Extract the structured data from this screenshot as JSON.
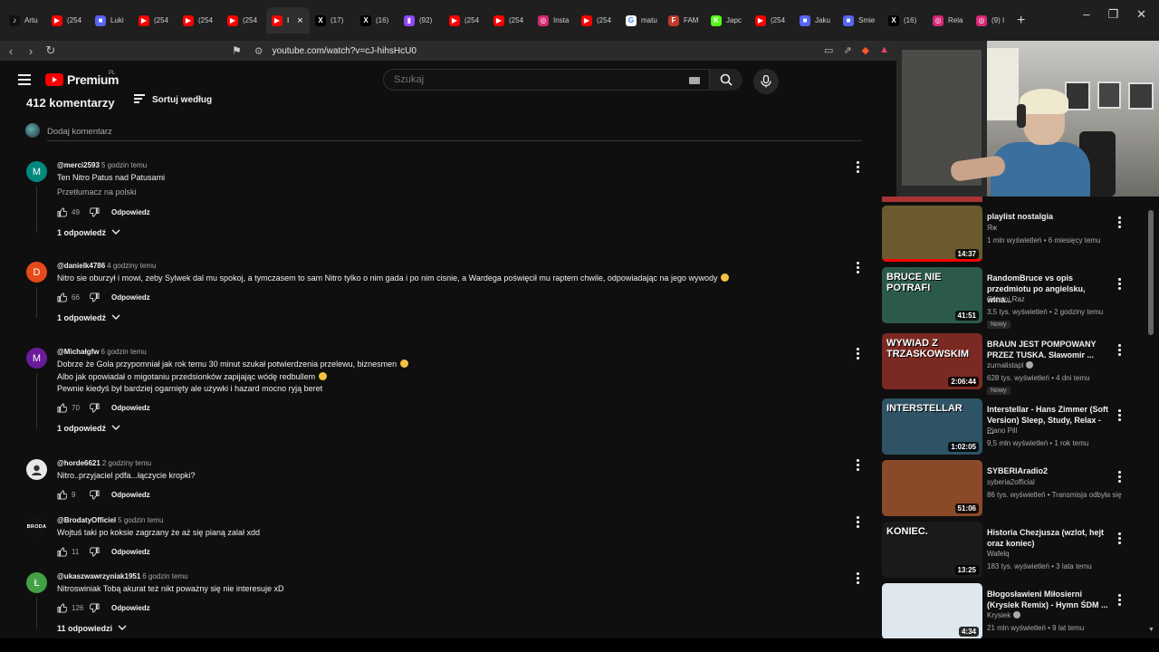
{
  "tabs": [
    {
      "label": "Artu",
      "icon": "tiktok-icon",
      "color": "#111111",
      "glyph": "♪"
    },
    {
      "label": "(254",
      "icon": "youtube-icon",
      "color": "#ff0000",
      "glyph": "▶"
    },
    {
      "label": "Luki",
      "icon": "app-icon",
      "color": "#5865f2",
      "glyph": "■"
    },
    {
      "label": "(254",
      "icon": "youtube-icon",
      "color": "#ff0000",
      "glyph": "▶"
    },
    {
      "label": "(254",
      "icon": "youtube-icon",
      "color": "#ff0000",
      "glyph": "▶"
    },
    {
      "label": "(254",
      "icon": "youtube-icon",
      "color": "#ff0000",
      "glyph": "▶"
    },
    {
      "label": "I",
      "icon": "youtube-icon",
      "color": "#ff0000",
      "glyph": "▶",
      "active": true
    },
    {
      "label": "(17)",
      "icon": "x-icon",
      "color": "#000000",
      "glyph": "X"
    },
    {
      "label": "(16)",
      "icon": "x-icon",
      "color": "#000000",
      "glyph": "X"
    },
    {
      "label": "(92)",
      "icon": "twitch-icon",
      "color": "#9146ff",
      "glyph": "▮"
    },
    {
      "label": "(254",
      "icon": "youtube-icon",
      "color": "#ff0000",
      "glyph": "▶"
    },
    {
      "label": "(254",
      "icon": "youtube-icon",
      "color": "#ff0000",
      "glyph": "▶"
    },
    {
      "label": "Insta",
      "icon": "instagram-icon",
      "color": "#d62976",
      "glyph": "◎"
    },
    {
      "label": "(254",
      "icon": "youtube-icon",
      "color": "#ff0000",
      "glyph": "▶"
    },
    {
      "label": "matu",
      "icon": "google-icon",
      "color": "#ffffff",
      "glyph": "G"
    },
    {
      "label": "FAM",
      "icon": "fame-icon",
      "color": "#c0392b",
      "glyph": "F"
    },
    {
      "label": "Japc",
      "icon": "kick-icon",
      "color": "#53fc18",
      "glyph": "K"
    },
    {
      "label": "(254",
      "icon": "youtube-icon",
      "color": "#ff0000",
      "glyph": "▶"
    },
    {
      "label": "Jaku",
      "icon": "app-icon",
      "color": "#5865f2",
      "glyph": "■"
    },
    {
      "label": "Smie",
      "icon": "app-icon",
      "color": "#5865f2",
      "glyph": "■"
    },
    {
      "label": "(16)",
      "icon": "x-icon",
      "color": "#000000",
      "glyph": "X"
    },
    {
      "label": "Rela",
      "icon": "instagram-icon",
      "color": "#d62976",
      "glyph": "◎"
    },
    {
      "label": "(9) I",
      "icon": "instagram-icon",
      "color": "#d62976",
      "glyph": "◎"
    }
  ],
  "address_bar": {
    "url": "youtube.com/watch?v=cJ-hihsHcU0"
  },
  "masthead": {
    "logo_text": "Premium",
    "region": "PL",
    "search_placeholder": "Szukaj"
  },
  "comments_section": {
    "count_label": "412 komentarzy",
    "sort_label": "Sortuj według",
    "add_comment_placeholder": "Dodaj komentarz"
  },
  "comments": [
    {
      "author": "@merci2593",
      "time": "5 godzin temu",
      "avatar_letter": "M",
      "avatar_color": "#00897b",
      "lines": [
        "Ten Nitro Patus nad Patusami"
      ],
      "translate": "Przetłumacz na polski",
      "likes": "49",
      "reply_label": "Odpowiedz",
      "replies_label": "1 odpowiedź"
    },
    {
      "author": "@danielk4786",
      "time": "4 godziny temu",
      "avatar_letter": "D",
      "avatar_color": "#e64a19",
      "lines": [
        "Nitro sie oburzył i mowi, zeby Sylwek dal mu spokoj, a tymczasem to sam Nitro tylko o nim gada i po nim cisnie, a Wardega poświęcił mu raptem chwile, odpowiadając na jego wywody"
      ],
      "likes": "66",
      "reply_label": "Odpowiedz",
      "replies_label": "1 odpowiedź"
    },
    {
      "author": "@Michałgfw",
      "time": "6 godzin temu",
      "avatar_letter": "M",
      "avatar_color": "#6a1b9a",
      "lines": [
        "Dobrze że Gola przypomniał jak rok temu 30 minut szukał potwierdzenia przelewu, biznesmen",
        "Albo jak opowiadał o migotaniu przedsionków zapijając wódę redbullem",
        "Pewnie kiedyś był bardziej ogarnięty ale używki i hazard mocno ryją beret"
      ],
      "likes": "70",
      "reply_label": "Odpowiedz",
      "replies_label": "1 odpowiedź"
    },
    {
      "author": "@horde6621",
      "time": "2 godziny temu",
      "avatar_letter": "",
      "avatar_color": "#e8e8e8",
      "lines": [
        "Nitro..przyjaciel pdfa...łączycie kropki?"
      ],
      "likes": "9",
      "reply_label": "Odpowiedz"
    },
    {
      "author": "@BrodatyOfficiel",
      "time": "5 godzin temu",
      "avatar_letter": "BRODA",
      "avatar_color": "#111111",
      "lines": [
        "Wojtuś taki po koksie zagrzany że aż się pianą zalał xdd"
      ],
      "likes": "11",
      "reply_label": "Odpowiedz"
    },
    {
      "author": "@ukaszwawrzyniak1951",
      "time": "6 godzin temu",
      "avatar_letter": "Ł",
      "avatar_color": "#43a047",
      "lines": [
        "Nitroswiniak Tobą akurat też nikt poważny się nie interesuje xD"
      ],
      "likes": "126",
      "reply_label": "Odpowiedz",
      "replies_label": "11 odpowiedzi"
    }
  ],
  "sidebar": [
    {
      "title": "playlist nostalgia",
      "channel": "Яж",
      "meta": "1 mln wyświetleń • 6 miesięcy temu",
      "duration": "14:37",
      "thumb_color": "#6b5a2e",
      "progress": 1.0
    },
    {
      "title": "RandomBruce vs opis przedmiotu po angielsku, wina...",
      "channel": "Ostatni Raz",
      "meta": "3,5 tys. wyświetleń • 2 godziny temu",
      "badge": "Nowy",
      "duration": "41:51",
      "thumb_color": "#2c5a4a",
      "thumb_text": "BRUCE NIE POTRAFI"
    },
    {
      "title": "BRAUN JEST POMPOWANY PRZEZ TUSKA. Sławomir ...",
      "channel": "zurnalistapl",
      "verified": true,
      "meta": "628 tys. wyświetleń • 4 dni temu",
      "badge": "Nowy",
      "duration": "2:06:44",
      "thumb_color": "#7a2a22",
      "thumb_text": "WYWIAD Z TRZASKOWSKIM"
    },
    {
      "title": "Interstellar - Hans Zimmer (Soft Version) Sleep, Study, Relax - ...",
      "channel": "Piano Pill",
      "meta": "9,5 mln wyświetleń • 1 rok temu",
      "duration": "1:02:05",
      "thumb_color": "#2e5364",
      "thumb_text": "INTERSTELLAR"
    },
    {
      "title": "SYBERIAradio2",
      "channel": "syberia2official",
      "meta": "86 tys. wyświetleń • Transmisja odbyła się",
      "duration": "51:06",
      "thumb_color": "#8a4a2a"
    },
    {
      "title": "Historia Chezjusza (wzlot, hejt oraz koniec)",
      "channel": "Wafelq",
      "meta": "183 tys. wyświetleń • 3 lata temu",
      "duration": "13:25",
      "thumb_color": "#1a1a1a",
      "thumb_text": "KONIEC."
    },
    {
      "title": "Błogosławieni Miłosierni (Krysiek Remix) - Hymn ŚDM ...",
      "channel": "Krysiek",
      "verified": true,
      "meta": "21 mln wyświetleń • 9 lat temu",
      "duration": "4:34",
      "thumb_color": "#dfe8ef"
    }
  ]
}
